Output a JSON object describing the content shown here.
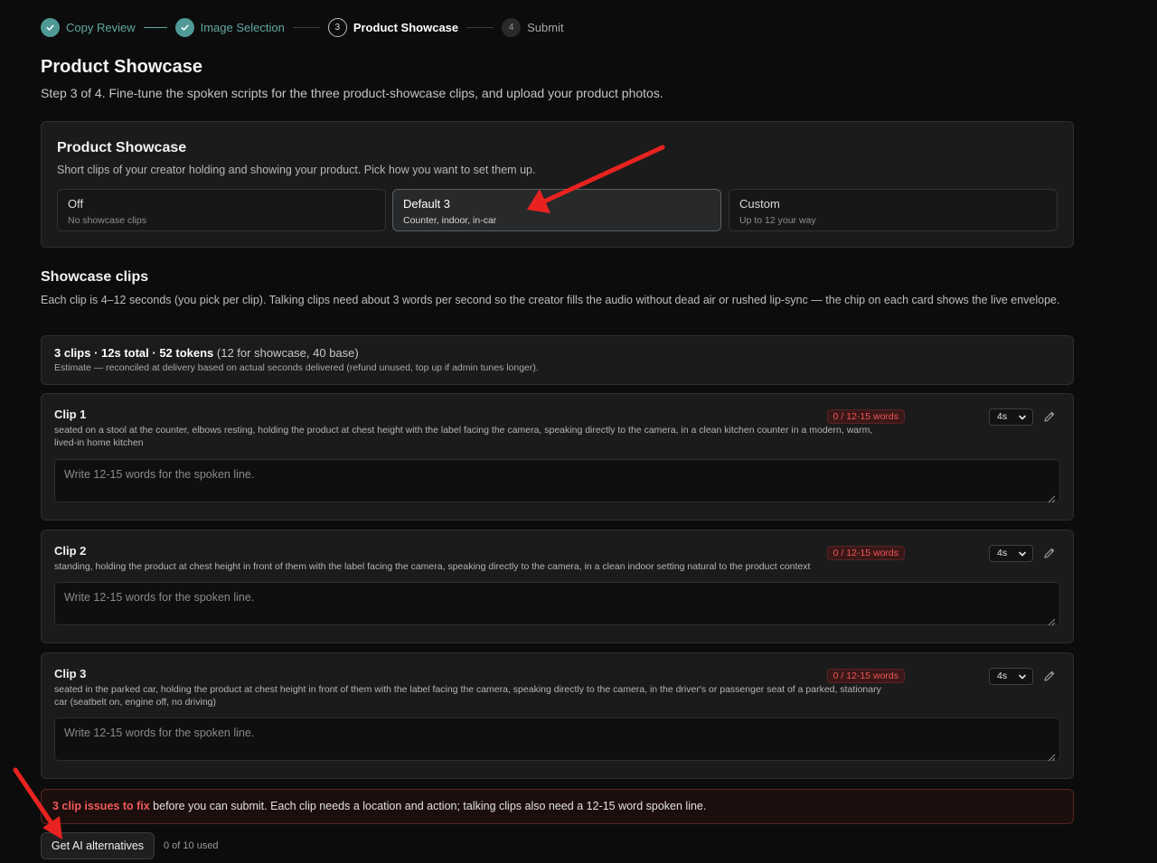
{
  "stepper": {
    "steps": [
      {
        "number": "",
        "label": "Copy Review",
        "status": "done"
      },
      {
        "number": "",
        "label": "Image Selection",
        "status": "done"
      },
      {
        "number": "3",
        "label": "Product Showcase",
        "status": "current"
      },
      {
        "number": "4",
        "label": "Submit",
        "status": "pending"
      }
    ]
  },
  "page": {
    "title": "Product Showcase",
    "subtitle": "Step 3 of 4. Fine-tune the spoken scripts for the three product-showcase clips, and upload your product photos."
  },
  "showcase_panel": {
    "title": "Product Showcase",
    "description": "Short clips of your creator holding and showing your product. Pick how you want to set them up.",
    "options": [
      {
        "title": "Off",
        "subtitle": "No showcase clips",
        "selected": false
      },
      {
        "title": "Default 3",
        "subtitle": "Counter, indoor, in-car",
        "selected": true
      },
      {
        "title": "Custom",
        "subtitle": "Up to 12 your way",
        "selected": false
      }
    ]
  },
  "clips_section": {
    "title": "Showcase clips",
    "description": "Each clip is 4–12 seconds (you pick per clip). Talking clips need about 3 words per second so the creator fills the audio without dead air or rushed lip-sync — the chip on each card shows the live envelope."
  },
  "summary": {
    "strong": "3 clips · 12s total · 52 tokens",
    "detail": " (12 for showcase, 40 base)",
    "estimate": "Estimate — reconciled at delivery based on actual seconds delivered (refund unused, top up if admin tunes longer)."
  },
  "clips": [
    {
      "title": "Clip 1",
      "description": "seated on a stool at the counter, elbows resting, holding the product at chest height with the label facing the camera, speaking directly to the camera, in a clean kitchen counter in a modern, warm, lived-in home kitchen",
      "word_chip": "0 / 12-15 words",
      "duration": "4s",
      "placeholder": "Write 12-15 words for the spoken line."
    },
    {
      "title": "Clip 2",
      "description": "standing, holding the product at chest height in front of them with the label facing the camera, speaking directly to the camera, in a clean indoor setting natural to the product context",
      "word_chip": "0 / 12-15 words",
      "duration": "4s",
      "placeholder": "Write 12-15 words for the spoken line."
    },
    {
      "title": "Clip 3",
      "description": "seated in the parked car, holding the product at chest height in front of them with the label facing the camera, speaking directly to the camera, in the driver's or passenger seat of a parked, stationary car (seatbelt on, engine off, no driving)",
      "word_chip": "0 / 12-15 words",
      "duration": "4s",
      "placeholder": "Write 12-15 words for the spoken line."
    }
  ],
  "error": {
    "strong": "3 clip issues to fix",
    "message": " before you can submit. Each clip needs a location and action; talking clips also need a 12-15 word spoken line."
  },
  "ai": {
    "button_label": "Get AI alternatives",
    "usage": "0 of 10 used"
  },
  "colors": {
    "accent_teal": "#4f9a96",
    "error_red": "#ef5454",
    "annotation_arrow": "#e8231f"
  },
  "icons": {
    "completed_step": "check-icon",
    "duration_dropdown": "chevron-down-icon",
    "edit": "pencil-icon",
    "textarea_resize": "resize-grip-icon"
  }
}
